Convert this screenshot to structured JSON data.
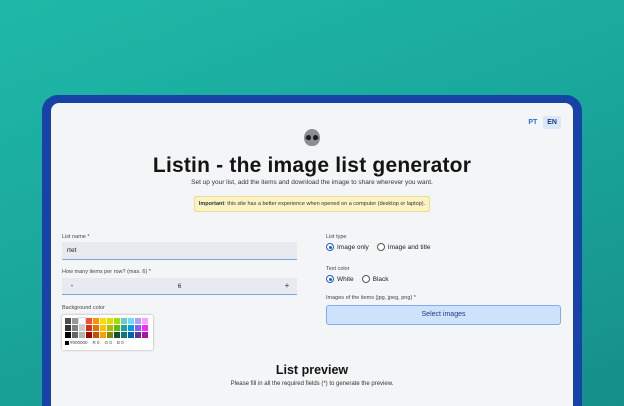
{
  "lang": {
    "pt": "PT",
    "en": "EN"
  },
  "title": "Listin - the image list generator",
  "subtitle": "Set up your list, add the items and download the image to share wherever you want.",
  "notice": {
    "strong": "Important",
    "text": ": this site has a better experience when opened on a computer (desktop or laptop)."
  },
  "list_name": {
    "label": "List name *",
    "value": "rtet"
  },
  "items_per_row": {
    "label": "How many items per row? (max. 6) *",
    "value": "6",
    "minus": "-",
    "plus": "+"
  },
  "background": {
    "label": "Background color",
    "hex": "#000000",
    "r": "0",
    "g": "0",
    "b": "0",
    "r_label": "R",
    "g_label": "G",
    "b_label": "B",
    "colors": [
      "#4d4d4d",
      "#999999",
      "#ffffff",
      "#f44e3b",
      "#fe9200",
      "#fcdc00",
      "#dbdf00",
      "#a4dd00",
      "#68ccca",
      "#73d8ff",
      "#aea1ff",
      "#fda1ff",
      "#333333",
      "#808080",
      "#cccccc",
      "#d33115",
      "#e27300",
      "#fcc400",
      "#b0bc00",
      "#68bc00",
      "#16a5a5",
      "#009ce0",
      "#7b64ff",
      "#fa28ff",
      "#000000",
      "#666666",
      "#b3b3b3",
      "#9f0500",
      "#c45100",
      "#fb9e00",
      "#808900",
      "#194d33",
      "#0c797d",
      "#0062b1",
      "#653294",
      "#ab149e"
    ]
  },
  "list_type": {
    "label": "List type",
    "options": [
      "Image only",
      "Image and title"
    ],
    "selected": 0
  },
  "text_color": {
    "label": "Text color",
    "options": [
      "White",
      "Black"
    ],
    "selected": 0
  },
  "images": {
    "label": "Images of the items (jpg, jpeg, png) *",
    "button": "Select images"
  },
  "preview": {
    "title": "List preview",
    "note": "Please fill in all the required fields (*) to generate the preview."
  }
}
